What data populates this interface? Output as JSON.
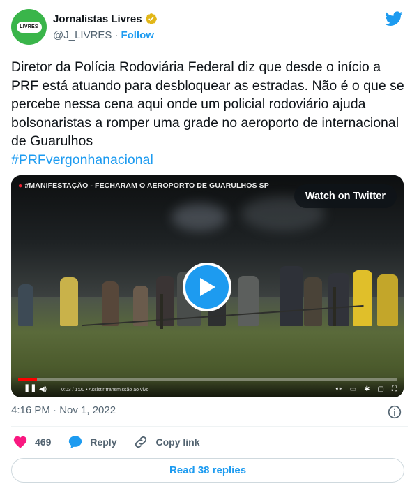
{
  "author": {
    "display_name": "Jornalistas Livres",
    "handle": "@J_LIVRES",
    "separator": "·",
    "follow_label": "Follow",
    "avatar_text": "LIVRES"
  },
  "tweet": {
    "text": "Diretor da Polícia Rodoviária Federal diz que desde o início a PRF está atuando para desbloquear as estradas. Não é o que se percebe nessa cena aqui onde um policial rodoviário ajuda bolsonaristas a romper uma grade no aeroporto de internacional de Guarulhos",
    "hashtag": "#PRFvergonhanacional"
  },
  "media": {
    "video_title": "#MANIFESTAÇÃO - FECHARAM O AEROPORTO DE GUARULHOS SP",
    "watch_label": "Watch on Twitter",
    "time_readout": "0:03 / 1:00 • Assistir transmissão ao vivo",
    "progress": 0.05
  },
  "meta": {
    "timestamp": "4:16 PM · Nov 1, 2022"
  },
  "actions": {
    "like_count": "469",
    "reply_label": "Reply",
    "copy_link_label": "Copy link"
  },
  "footer": {
    "read_replies_label": "Read 38 replies"
  },
  "colors": {
    "accent": "#1d9bf0",
    "like": "#f91880",
    "verified": "#e2b719",
    "muted": "#536471"
  },
  "icons": [
    "verified-icon",
    "twitter-bird-icon",
    "play-icon",
    "info-icon",
    "heart-icon",
    "reply-bubble-icon",
    "link-icon"
  ]
}
